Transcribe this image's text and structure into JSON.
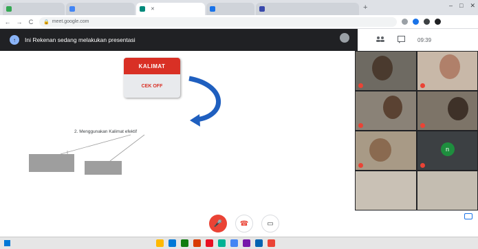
{
  "browser": {
    "tabs": [
      {
        "label": "",
        "favicon_color": "#34a853"
      },
      {
        "label": "",
        "favicon_color": "#4285f4"
      },
      {
        "label": "",
        "favicon_color": "#00897b"
      },
      {
        "label": "",
        "favicon_color": "#1a73e8"
      },
      {
        "label": "",
        "favicon_color": "#3949ab"
      }
    ],
    "new_tab_symbol": "+",
    "window_controls": [
      "–",
      "□",
      "✕"
    ],
    "nav": [
      "←",
      "→",
      "C"
    ],
    "url": "meet.google.com"
  },
  "presentation_bar": {
    "icon_symbol": "↑",
    "text": "Ini Rekenan sedang melakukan presentasi",
    "presenter_name": "",
    "presenter_sub": ""
  },
  "right_toolbar": {
    "people_symbol": "",
    "chat_symbol": "",
    "time": "09:39"
  },
  "slide": {
    "calendar_top": "KALIMAT",
    "calendar_body": "CEK OFF",
    "caption": "2. Menggunakan Kalimat efektif",
    "box_left": "",
    "box_right": ""
  },
  "participants": [
    {
      "name": "",
      "bg": "#6e6a62",
      "face": "#4a3a2e"
    },
    {
      "name": "",
      "bg": "#c8b8a8",
      "face": "#b0806a"
    },
    {
      "name": "",
      "bg": "#8a8277",
      "face": "#5a4232"
    },
    {
      "name": "",
      "bg": "#7d7468",
      "face": "#3e3128"
    },
    {
      "name": "",
      "bg": "#a89a86",
      "face": "#8a6a50"
    },
    {
      "name": "",
      "bg": "#3c4043",
      "face": "",
      "avatar_letter": "n"
    },
    {
      "name": "",
      "bg": "#c9c1b5",
      "face": ""
    },
    {
      "name": "",
      "bg": "#c4bdb1",
      "face": ""
    }
  ],
  "controls": {
    "meeting_code": "",
    "mic_symbol": "🎤",
    "end_symbol": "☎",
    "cam_symbol": "▭",
    "presenting_line1": "",
    "presenting_line2": "",
    "more_symbol": "⋮"
  },
  "taskbar": {
    "search_text": "",
    "app_colors": [
      "#ffb900",
      "#0078d7",
      "#107c10",
      "#d83b01",
      "#e81123",
      "#00b294",
      "#4285f4",
      "#7719aa",
      "#0063b1",
      "#ea4335"
    ],
    "tray_text": ""
  }
}
